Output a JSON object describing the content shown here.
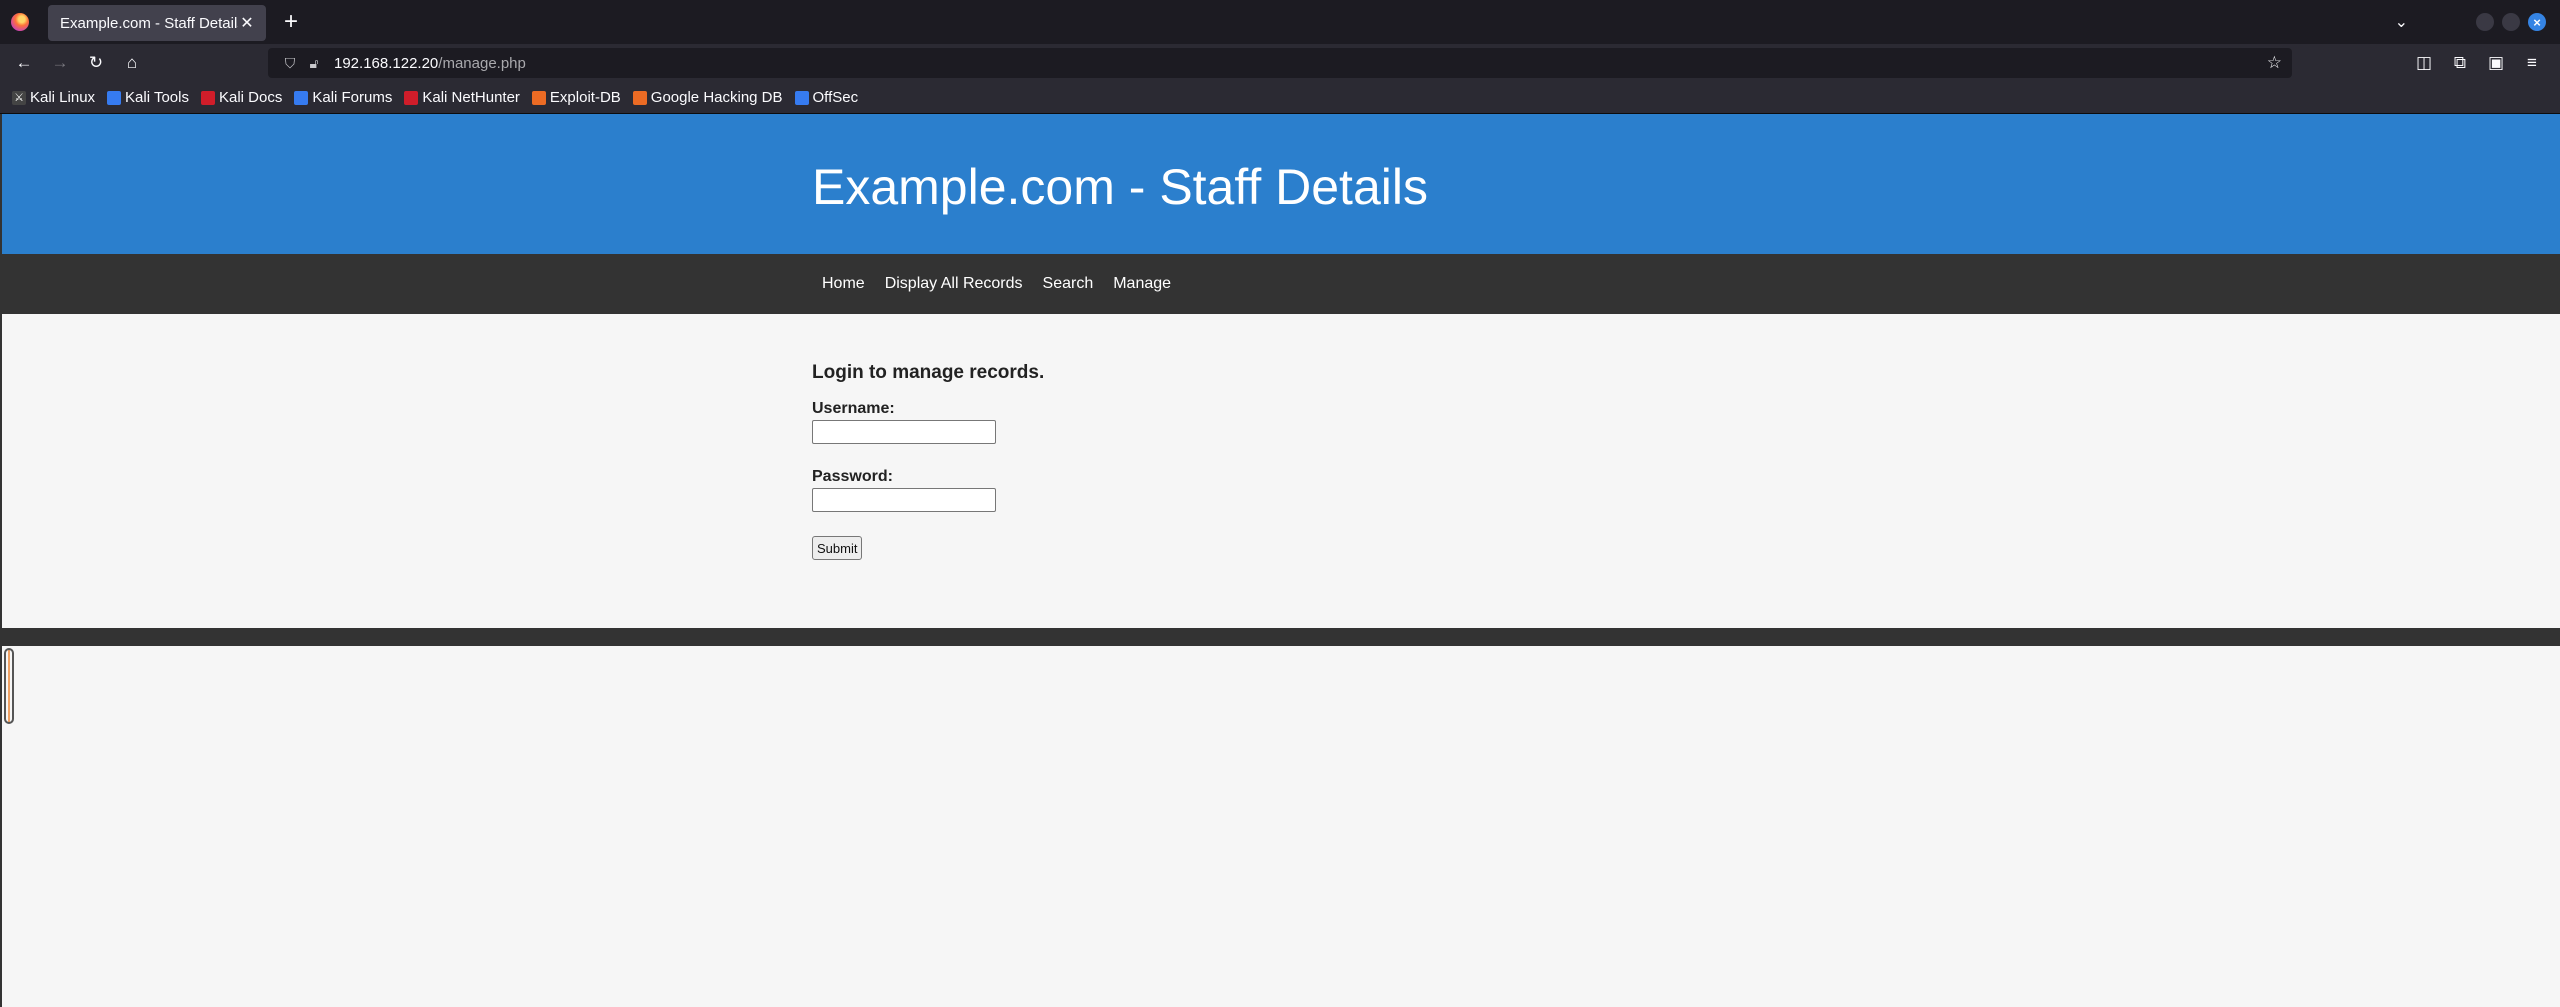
{
  "browser": {
    "tab_title": "Example.com - Staff Details",
    "tab_close": "✕",
    "new_tab": "+",
    "url_host": "192.168.122.20",
    "url_path": "/manage.php",
    "bookmarks": [
      {
        "label": "Kali Linux",
        "color": "#1c1b22"
      },
      {
        "label": "Kali Tools",
        "color": "#367bf0"
      },
      {
        "label": "Kali Docs",
        "color": "#d01d2a"
      },
      {
        "label": "Kali Forums",
        "color": "#367bf0"
      },
      {
        "label": "Kali NetHunter",
        "color": "#d01d2a"
      },
      {
        "label": "Exploit-DB",
        "color": "#ec6b24"
      },
      {
        "label": "Google Hacking DB",
        "color": "#ec6b24"
      },
      {
        "label": "OffSec",
        "color": "#367bf0"
      }
    ]
  },
  "site": {
    "title": "Example.com - Staff Details",
    "nav": [
      "Home",
      "Display All Records",
      "Search",
      "Manage"
    ],
    "header_color": "#2b7fcd",
    "nav_color": "#333333"
  },
  "login": {
    "heading": "Login to manage records.",
    "username_label": "Username:",
    "username_value": "",
    "password_label": "Password:",
    "password_value": "",
    "submit_label": "Submit"
  }
}
